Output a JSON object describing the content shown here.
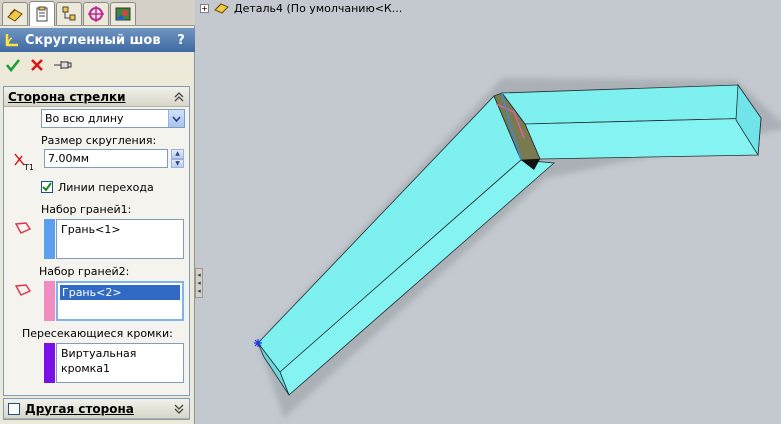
{
  "tabs": [
    {
      "name": "feature-manager",
      "icon": "feature-tree-icon"
    },
    {
      "name": "property-manager",
      "icon": "property-manager-icon",
      "active": true
    },
    {
      "name": "configuration-manager",
      "icon": "configuration-icon"
    },
    {
      "name": "dimxpert-manager",
      "icon": "dimxpert-icon"
    },
    {
      "name": "display-manager",
      "icon": "display-manager-icon"
    }
  ],
  "property_manager": {
    "title": "Скругленный шов",
    "help": "?",
    "actions": {
      "ok": "ok-icon",
      "cancel": "cancel-icon",
      "pin": "pin-icon"
    }
  },
  "arrow_side": {
    "title": "Сторона стрелки",
    "extent": "Во всю длину",
    "fillet_size_label": "Размер скругления:",
    "fillet_size": "7.00мм",
    "tangent_label": "Линии перехода",
    "tangent_checked": true,
    "face_set1_label": "Набор граней1:",
    "face_set1_items": [
      "Грань<1>"
    ],
    "face_set2_label": "Набор граней2:",
    "face_set2_items": [
      "Грань<2>"
    ],
    "edges_label": "Пересекающиеся кромки:",
    "edges_items": [
      "Виртуальная кромка1"
    ],
    "colors": {
      "set1": "#5aa0ec",
      "set2": "#f08cc0",
      "edges": "#7a10e8"
    }
  },
  "other_side": {
    "title": "Другая сторона",
    "checked": false
  },
  "tree": {
    "root": "Деталь4  (По умолчанию<К..."
  },
  "colors": {
    "model_face": "#7ff0f0",
    "background": "#c3c9cf",
    "title_bar": "#3f6aa2"
  }
}
